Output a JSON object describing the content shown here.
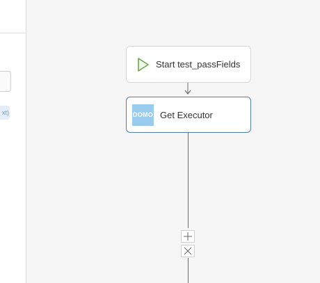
{
  "left_panel": {
    "chip_text": "xt)"
  },
  "flow": {
    "start_node": {
      "label": "Start test_passFields",
      "icon": "play-icon",
      "icon_color": "#6aa84f"
    },
    "executor_node": {
      "label": "Get Executor",
      "logo_text": "DOMO",
      "logo_color": "#99cbec",
      "border_color": "#4d7ea8"
    },
    "controls": {
      "add": "add-step",
      "delete": "delete-step"
    }
  }
}
